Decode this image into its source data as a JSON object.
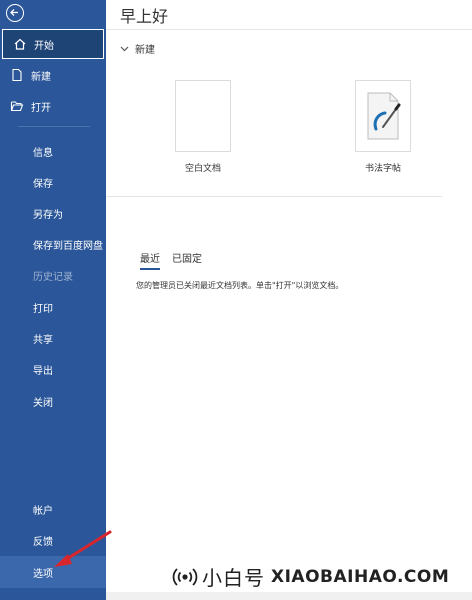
{
  "sidebar": {
    "items": [
      {
        "label": "开始",
        "icon": "home-icon"
      },
      {
        "label": "新建",
        "icon": "new-document-icon"
      },
      {
        "label": "打开",
        "icon": "open-folder-icon"
      },
      {
        "label": "信息"
      },
      {
        "label": "保存"
      },
      {
        "label": "另存为"
      },
      {
        "label": "保存到百度网盘"
      },
      {
        "label": "历史记录"
      },
      {
        "label": "打印"
      },
      {
        "label": "共享"
      },
      {
        "label": "导出"
      },
      {
        "label": "关闭"
      },
      {
        "label": "帐户"
      },
      {
        "label": "反馈"
      },
      {
        "label": "选项"
      }
    ]
  },
  "main": {
    "greeting": "早上好",
    "new_section": "新建",
    "templates": [
      {
        "label": "空白文档"
      },
      {
        "label": "书法字帖"
      }
    ],
    "tabs": [
      "最近",
      "已固定"
    ],
    "notice": "您的管理员已关闭最近文档列表。单击\"打开\"以浏览文档。"
  },
  "watermark": {
    "chinese": "小白号",
    "url": "XIAOBAIHAO.COM"
  },
  "colors": {
    "sidebar": "#2b579a",
    "accent": "#2b579a",
    "arrow": "#d9262c"
  }
}
